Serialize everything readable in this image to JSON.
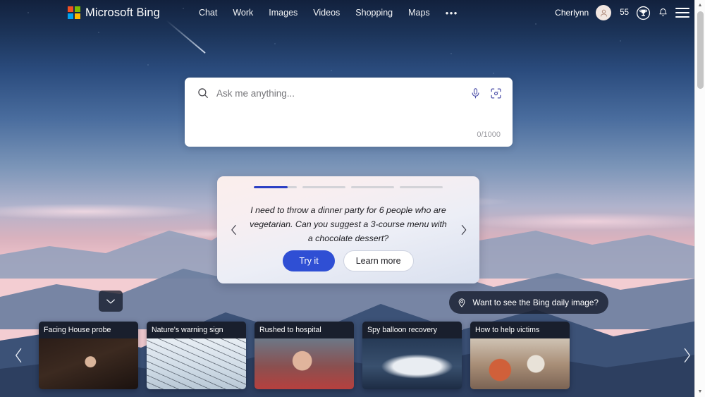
{
  "header": {
    "brand": "Microsoft Bing",
    "logo_icon": "microsoft-logo-icon",
    "logo_colors": [
      "#f25022",
      "#7fba00",
      "#00a4ef",
      "#ffb900"
    ],
    "nav": [
      {
        "label": "Chat",
        "name": "nav-chat"
      },
      {
        "label": "Work",
        "name": "nav-work"
      },
      {
        "label": "Images",
        "name": "nav-images"
      },
      {
        "label": "Videos",
        "name": "nav-videos"
      },
      {
        "label": "Shopping",
        "name": "nav-shopping"
      },
      {
        "label": "Maps",
        "name": "nav-maps"
      }
    ],
    "more_label": "•••",
    "user_name": "Cherlynn",
    "avatar_icon": "person-avatar-icon",
    "points": "55",
    "rewards_icon": "trophy-rewards-icon",
    "notifications_icon": "bell-icon",
    "menu_icon": "hamburger-menu-icon"
  },
  "search": {
    "placeholder": "Ask me anything...",
    "value": "",
    "search_icon": "search-icon",
    "mic_icon": "microphone-icon",
    "visual_search_icon": "visual-search-camera-icon",
    "counter": "0/1000"
  },
  "suggestion": {
    "prev_icon": "chevron-left-icon",
    "next_icon": "chevron-right-icon",
    "text": "I need to throw a dinner party for 6 people who are vegetarian. Can you suggest a 3-course menu with a chocolate dessert?",
    "try_label": "Try it",
    "learn_label": "Learn more",
    "progress": {
      "total": 4,
      "active_index": 0,
      "active_fill_percent": 78,
      "active_color": "#2b3fc4",
      "track_color": "#d3d3d8"
    }
  },
  "daily_image_pill": {
    "label": "Want to see the Bing daily image?",
    "icon": "location-pin-icon"
  },
  "expand_button": {
    "icon": "chevron-down-icon"
  },
  "carousel": {
    "prev_icon": "chevron-left-icon",
    "next_icon": "chevron-right-icon",
    "cards": [
      {
        "title": "Facing House probe",
        "thumb": "thumb-hearing"
      },
      {
        "title": "Nature's warning sign",
        "thumb": "thumb-wires"
      },
      {
        "title": "Rushed to hospital",
        "thumb": "thumb-hospital"
      },
      {
        "title": "Spy balloon recovery",
        "thumb": "thumb-balloon"
      },
      {
        "title": "How to help victims",
        "thumb": "thumb-victims"
      }
    ]
  },
  "scrollbar": {
    "up_icon": "scroll-up-arrow-icon",
    "down_icon": "scroll-down-arrow-icon",
    "up_glyph": "▲",
    "down_glyph": "▼"
  },
  "theme": {
    "accent_blue": "#2f4fd4",
    "sky_top": "#12213d",
    "sky_bottom": "#f3cdd2",
    "card_dark": "#181e2c"
  }
}
